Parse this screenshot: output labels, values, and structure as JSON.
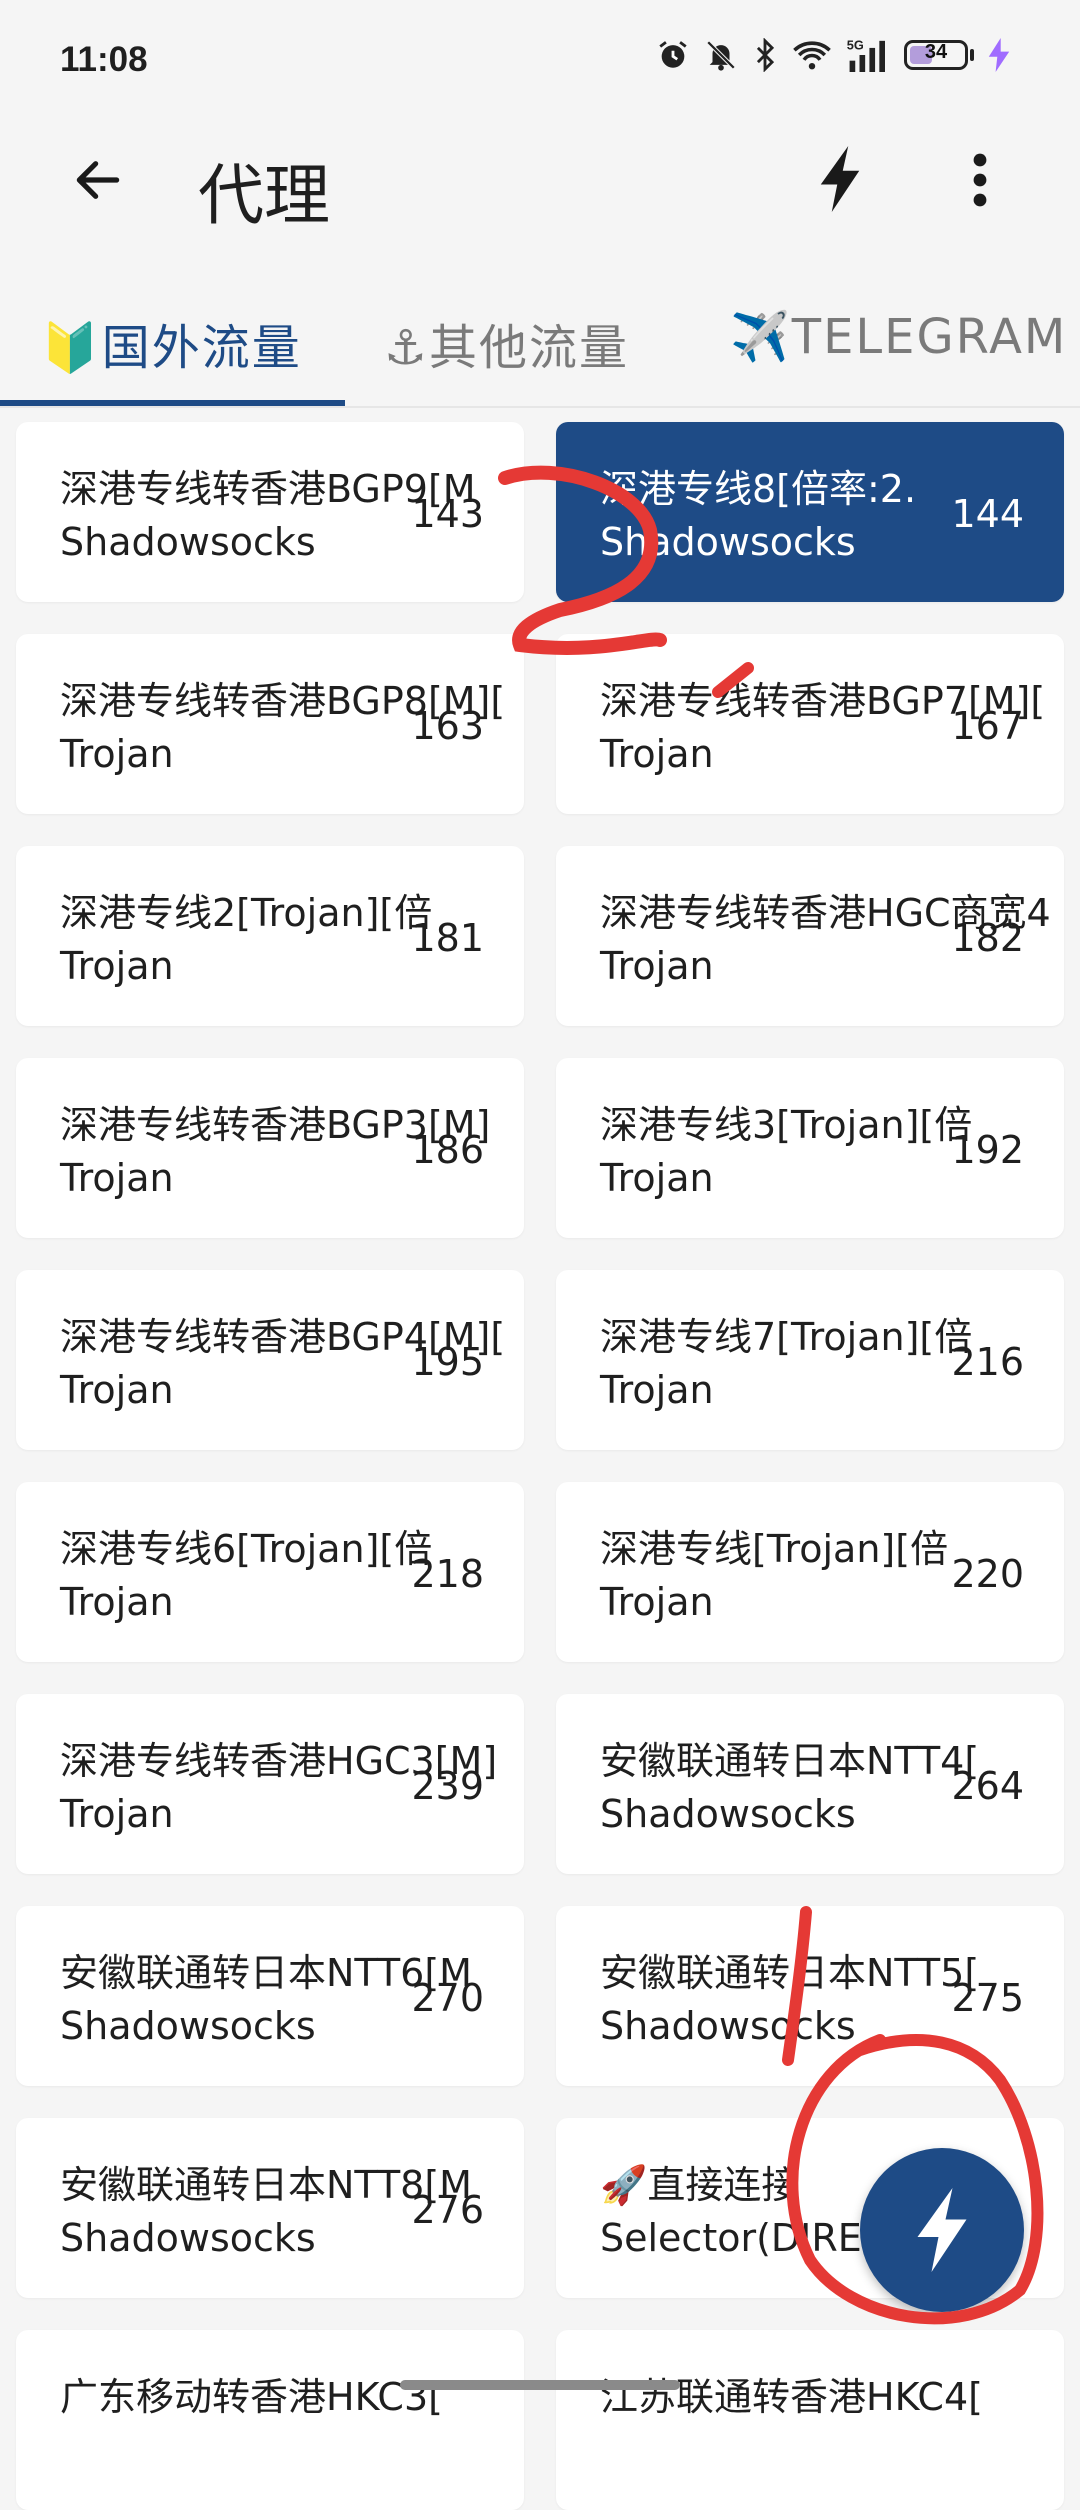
{
  "status": {
    "time": "11:08",
    "battery": "34",
    "network": "5G"
  },
  "appbar": {
    "title": "代理"
  },
  "tabs": [
    {
      "label": "🔰国外流量"
    },
    {
      "label": "⚓其他流量"
    },
    {
      "label": "✈️TELEGRAM"
    }
  ],
  "proxies": [
    {
      "name": "深港专线转香港BGP9[M",
      "type": "Shadowsocks",
      "delay": "143"
    },
    {
      "name": "深港专线8[倍率:2.",
      "type": "Shadowsocks",
      "delay": "144"
    },
    {
      "name": "深港专线转香港BGP8[M][",
      "type": "Trojan",
      "delay": "163"
    },
    {
      "name": "深港专线转香港BGP7[M][",
      "type": "Trojan",
      "delay": "167"
    },
    {
      "name": "深港专线2[Trojan][倍",
      "type": "Trojan",
      "delay": "181"
    },
    {
      "name": "深港专线转香港HGC商宽4",
      "type": "Trojan",
      "delay": "182"
    },
    {
      "name": "深港专线转香港BGP3[M]",
      "type": "Trojan",
      "delay": "186"
    },
    {
      "name": "深港专线3[Trojan][倍",
      "type": "Trojan",
      "delay": "192"
    },
    {
      "name": "深港专线转香港BGP4[M][",
      "type": "Trojan",
      "delay": "195"
    },
    {
      "name": "深港专线7[Trojan][倍",
      "type": "Trojan",
      "delay": "216"
    },
    {
      "name": "深港专线6[Trojan][倍",
      "type": "Trojan",
      "delay": "218"
    },
    {
      "name": "深港专线[Trojan][倍",
      "type": "Trojan",
      "delay": "220"
    },
    {
      "name": "深港专线转香港HGC3[M]",
      "type": "Trojan",
      "delay": "239"
    },
    {
      "name": "安徽联通转日本NTT4[",
      "type": "Shadowsocks",
      "delay": "264"
    },
    {
      "name": "安徽联通转日本NTT6[M",
      "type": "Shadowsocks",
      "delay": "270"
    },
    {
      "name": "安徽联通转日本NTT5[",
      "type": "Shadowsocks",
      "delay": "275"
    },
    {
      "name": "安徽联通转日本NTT8[M",
      "type": "Shadowsocks",
      "delay": "276"
    },
    {
      "name": "🚀直接连接",
      "type": "Selector(DIREC",
      "delay": ""
    },
    {
      "name": "广东移动转香港HKC3[",
      "type": "",
      "delay": ""
    },
    {
      "name": "江苏联通转香港HKC4[",
      "type": "",
      "delay": ""
    }
  ],
  "selected_index": 1,
  "colors": {
    "accent": "#1e4b86",
    "annotation": "#e53935"
  }
}
